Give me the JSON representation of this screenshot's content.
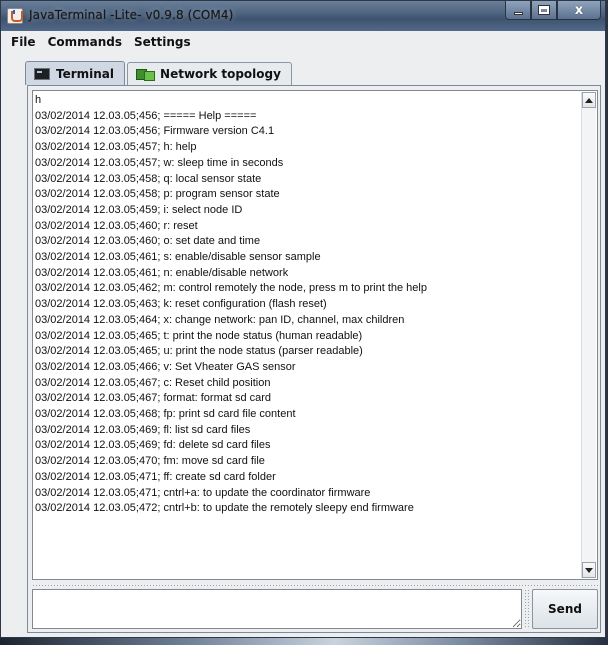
{
  "window": {
    "title": "JavaTerminal -Lite- v0.9.8 (COM4)",
    "controls": {
      "minimize": "",
      "maximize": "",
      "close": "x"
    }
  },
  "menu": {
    "items": [
      "File",
      "Commands",
      "Settings"
    ]
  },
  "tabs": [
    {
      "label": "Terminal",
      "icon": "terminal-icon",
      "active": true
    },
    {
      "label": "Network topology",
      "icon": "network-icon",
      "active": false
    }
  ],
  "terminal": {
    "lines": [
      "h",
      "03/02/2014 12.03.05;456; ===== Help =====",
      "03/02/2014 12.03.05;456; Firmware version C4.1",
      "03/02/2014 12.03.05;457; h: help",
      "03/02/2014 12.03.05;457; w: sleep time in seconds",
      "03/02/2014 12.03.05;458; q: local sensor state",
      "03/02/2014 12.03.05;458; p: program sensor state",
      "03/02/2014 12.03.05;459; i: select node ID",
      "03/02/2014 12.03.05;460; r: reset",
      "03/02/2014 12.03.05;460; o: set date and time",
      "03/02/2014 12.03.05;461; s: enable/disable sensor sample",
      "03/02/2014 12.03.05;461; n: enable/disable network",
      "03/02/2014 12.03.05;462; m: control remotely the node, press m to print the help",
      "03/02/2014 12.03.05;463; k: reset configuration (flash reset)",
      "03/02/2014 12.03.05;464; x: change network: pan ID, channel, max children",
      "03/02/2014 12.03.05;465; t: print the node status (human readable)",
      "03/02/2014 12.03.05;465; u: print the node status (parser readable)",
      "03/02/2014 12.03.05;466; v: Set Vheater GAS sensor",
      "03/02/2014 12.03.05;467; c: Reset child position",
      "03/02/2014 12.03.05;467; format: format sd card",
      "03/02/2014 12.03.05;468; fp: print sd card file content",
      "03/02/2014 12.03.05;469; fl: list sd card files",
      "03/02/2014 12.03.05;469; fd: delete sd card files",
      "03/02/2014 12.03.05;470; fm: move sd card file",
      "03/02/2014 12.03.05;471; ff: create sd card folder",
      "03/02/2014 12.03.05;471; cntrl+a: to update the coordinator firmware",
      "03/02/2014 12.03.05;472; cntrl+b: to update the remotely sleepy end firmware"
    ]
  },
  "input": {
    "value": "",
    "placeholder": ""
  },
  "send_label": "Send"
}
